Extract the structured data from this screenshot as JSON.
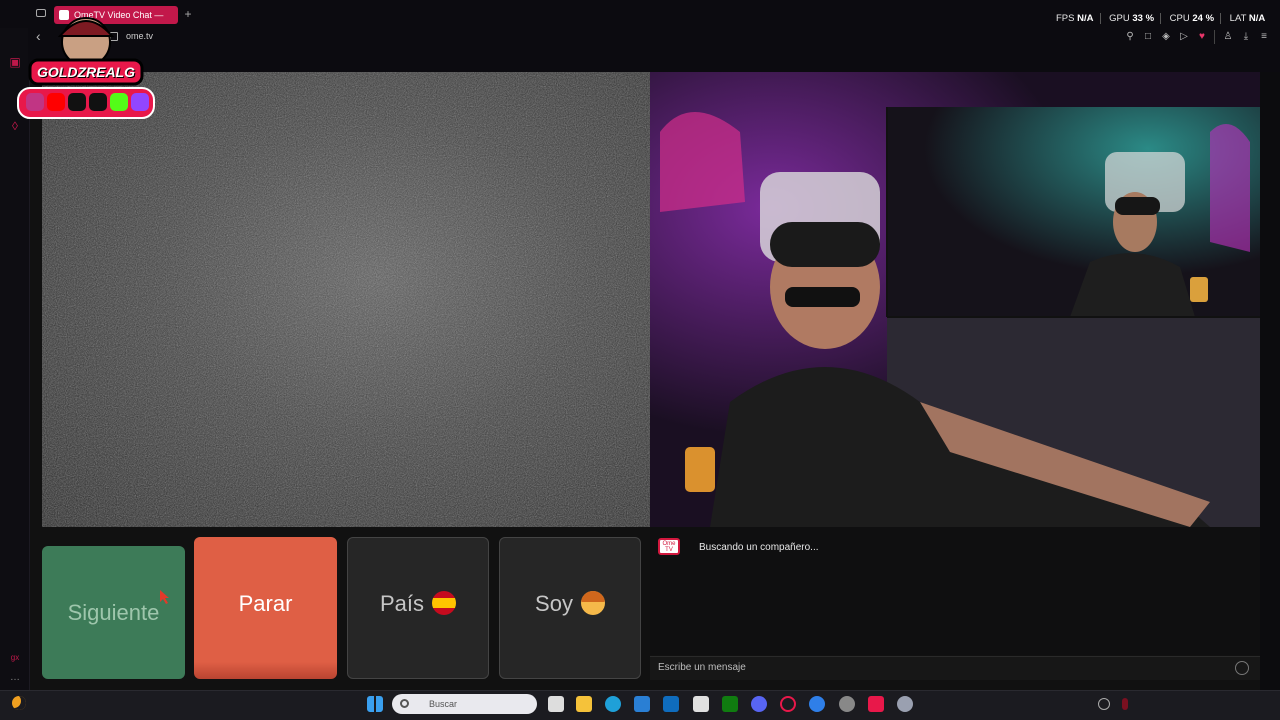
{
  "browser": {
    "tab_title": "OmeTV Video Chat —",
    "new_tab": "+",
    "url": "ome.tv",
    "back": "‹",
    "stats": {
      "fps_label": "FPS",
      "fps_value": "N/A",
      "gpu_label": "GPU",
      "gpu_value": "33 %",
      "cpu_label": "CPU",
      "cpu_value": "24 %",
      "lat_label": "LAT",
      "lat_value": "N/A"
    },
    "accent_color": "#c2184a"
  },
  "overlay": {
    "logo_text": "GOLDZREALG",
    "social_icons": [
      "instagram-icon",
      "youtube-icon",
      "tiktok-icon",
      "x-icon",
      "kick-icon",
      "twitch-icon"
    ]
  },
  "controls": {
    "next_label": "Siguiente",
    "stop_label": "Parar",
    "country_label": "País",
    "gender_label": "Soy"
  },
  "chat": {
    "app_badge": "Ome TV",
    "status_message": "Buscando un compañero...",
    "input_placeholder": "Escribe un mensaje"
  },
  "taskbar": {
    "search_placeholder": "Buscar",
    "apps": [
      "start-icon",
      "file-icon",
      "folder-icon",
      "edge-icon",
      "store-icon",
      "outlook-icon",
      "mail-icon",
      "xbox-icon",
      "discord-icon",
      "opera-gx-icon",
      "messenger-icon",
      "app-icon",
      "tiktok-icon",
      "settings-icon"
    ]
  },
  "colors": {
    "next": "#3d7b58",
    "stop": "#df5f45",
    "neutral": "#262626"
  }
}
